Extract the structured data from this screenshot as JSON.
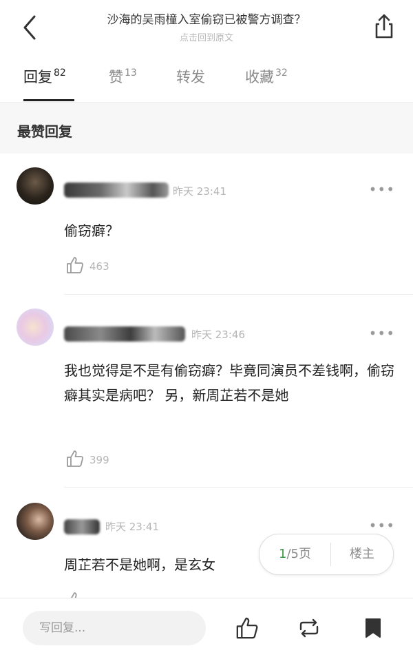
{
  "header": {
    "title": "沙海的吴雨橦入室偷窃已被警方调查？",
    "subtitle": "点击回到原文"
  },
  "tabs": [
    {
      "label": "回复",
      "count": "82"
    },
    {
      "label": "赞",
      "count": "13"
    },
    {
      "label": "转发",
      "count": ""
    },
    {
      "label": "收藏",
      "count": "32"
    }
  ],
  "section_title": "最赞回复",
  "comments": [
    {
      "time": "昨天 23:41",
      "text": "偷窃癖？",
      "likes": "463"
    },
    {
      "time": "昨天 23:46",
      "text": "我也觉得是不是有偷窃癖？毕竟同演员不差钱啊，偷窃癖其实是病吧？ 另，新周芷若不是她",
      "likes": "399"
    },
    {
      "time": "昨天 23:41",
      "text": "周芷若不是她啊，是玄女",
      "likes": ""
    }
  ],
  "pager": {
    "current": "1",
    "total_suffix": "/5页",
    "host_label": "楼主"
  },
  "bottom": {
    "reply_placeholder": "写回复..."
  }
}
